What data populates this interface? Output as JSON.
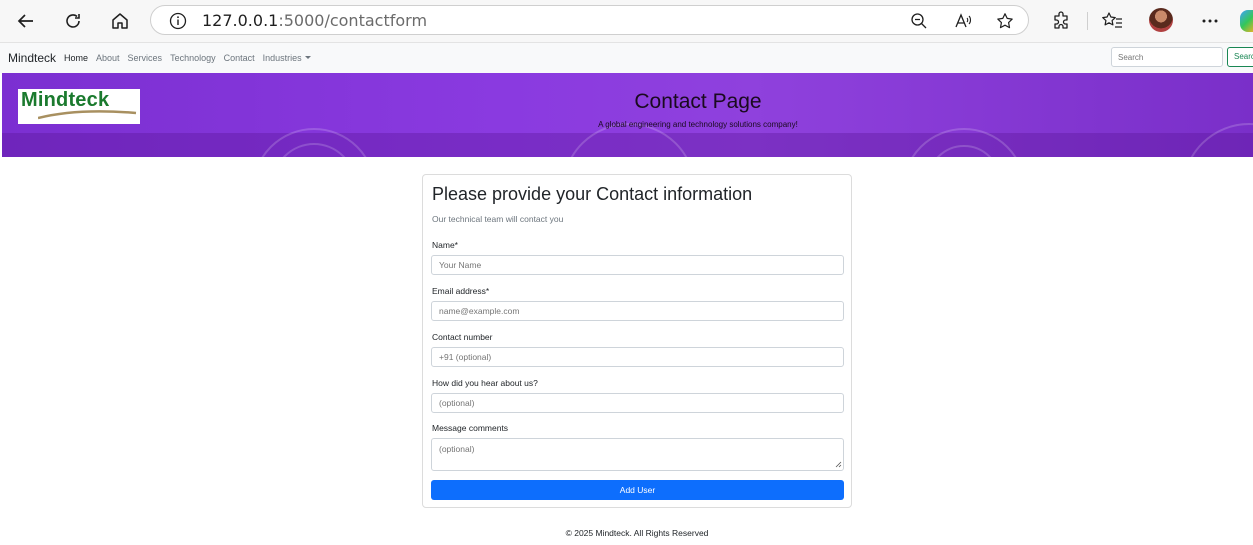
{
  "browser": {
    "url_host": "127.0.0.1",
    "url_path": ":5000/contactform",
    "icons": [
      "back-icon",
      "refresh-icon",
      "home-icon",
      "site-info-icon",
      "zoom-out-icon",
      "read-aloud-icon",
      "favorite-star-icon",
      "extensions-icon",
      "favorites-icon",
      "profile-avatar",
      "more-icon"
    ]
  },
  "navbar": {
    "brand": "Mindteck",
    "links": [
      "Home",
      "About",
      "Services",
      "Technology",
      "Contact"
    ],
    "dropdown": "Industries",
    "search_placeholder": "Search",
    "search_button": "Search"
  },
  "hero": {
    "logo_text": "Mindteck",
    "title": "Contact Page",
    "subtitle": "A global engineering and technology solutions company!"
  },
  "form": {
    "title": "Please provide your Contact information",
    "subtitle": "Our technical team will contact you",
    "fields": [
      {
        "label": "Name*",
        "placeholder": "Your Name"
      },
      {
        "label": "Email address*",
        "placeholder": "name@example.com"
      },
      {
        "label": "Contact number",
        "placeholder": "+91 (optional)"
      },
      {
        "label": "How did you hear about us?",
        "placeholder": "(optional)"
      },
      {
        "label": "Message comments",
        "placeholder": "(optional)"
      }
    ],
    "submit": "Add User"
  },
  "footer": "© 2025 Mindteck. All Rights Reserved",
  "colors": {
    "primary": "#0d6efd",
    "hero_purple": "#8a3ae0",
    "logo_green": "#1b7a2e",
    "search_green": "#198754"
  }
}
